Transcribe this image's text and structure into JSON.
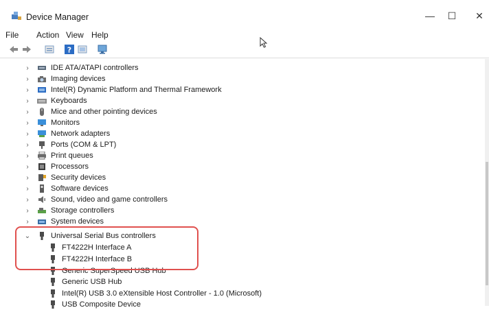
{
  "window": {
    "title": "Device Manager"
  },
  "window_controls": {
    "minimize": "—",
    "maximize": "☐",
    "close": "✕"
  },
  "menu": [
    "File",
    "Action",
    "View",
    "Help"
  ],
  "tree": {
    "categories": [
      "IDE ATA/ATAPI controllers",
      "Imaging devices",
      "Intel(R) Dynamic Platform and Thermal Framework",
      "Keyboards",
      "Mice and other pointing devices",
      "Monitors",
      "Network adapters",
      "Ports (COM & LPT)",
      "Print queues",
      "Processors",
      "Security devices",
      "Software devices",
      "Sound, video and game controllers",
      "Storage controllers",
      "System devices",
      "Universal Serial Bus controllers"
    ],
    "usb_children": [
      "FT4222H Interface A",
      "FT4222H Interface B",
      "Generic SuperSpeed USB Hub",
      "Generic USB Hub",
      "Intel(R) USB 3.0 eXtensible Host Controller - 1.0 (Microsoft)",
      "USB Composite Device"
    ]
  },
  "colors": {
    "highlight_box": "#e0504e",
    "accent_blue": "#2b6cc4"
  }
}
